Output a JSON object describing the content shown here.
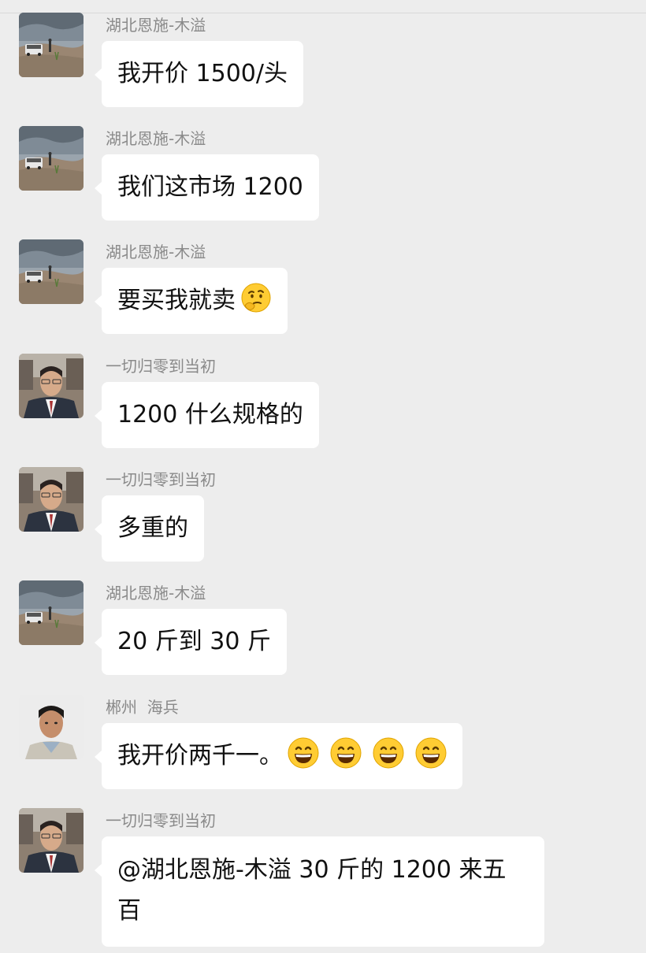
{
  "messages": [
    {
      "sender": "湖北恩施-木溢",
      "avatar": "car-landscape-avatar",
      "text": "我开价 1500/头"
    },
    {
      "sender": "湖北恩施-木溢",
      "avatar": "car-landscape-avatar",
      "text": "我们这市场 1200"
    },
    {
      "sender": "湖北恩施-木溢",
      "avatar": "car-landscape-avatar",
      "text": "要买我就卖",
      "emoji": [
        "thinking-face-emoji"
      ]
    },
    {
      "sender": "一切归零到当初",
      "avatar": "man-in-car-avatar",
      "text": "1200 什么规格的"
    },
    {
      "sender": "一切归零到当初",
      "avatar": "man-in-car-avatar",
      "text": "多重的"
    },
    {
      "sender": "湖北恩施-木溢",
      "avatar": "car-landscape-avatar",
      "text": "20 斤到 30 斤"
    },
    {
      "sender": "郴州  海兵",
      "avatar": "man-portrait-avatar",
      "text": "我开价两千一。",
      "emoji": [
        "grinning-face-emoji",
        "grinning-face-emoji",
        "grinning-face-emoji",
        "grinning-face-emoji"
      ]
    },
    {
      "sender": "一切归零到当初",
      "avatar": "man-in-car-avatar",
      "text": "@湖北恩施-木溢  30 斤的 1200 来五百"
    }
  ],
  "colors": {
    "background": "#ededed",
    "bubble": "#ffffff",
    "sender_name": "#8a8a8a",
    "message_text": "#111111"
  }
}
